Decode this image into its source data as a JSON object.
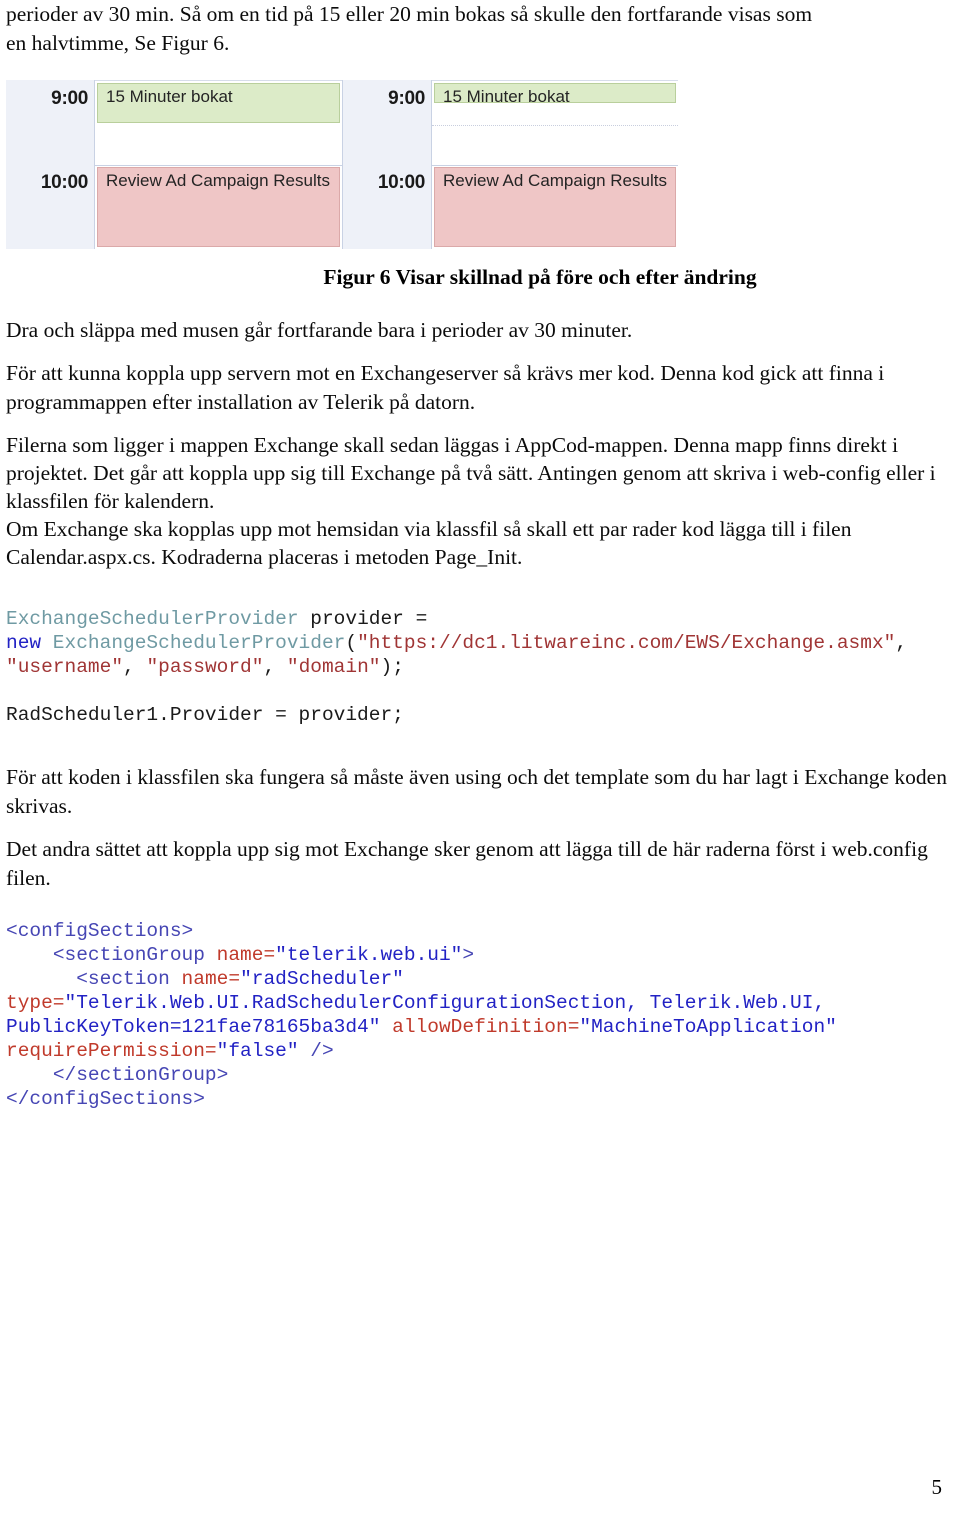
{
  "document": {
    "page_number": "5",
    "intro": {
      "line1": "perioder av 30 min. Så om en tid på 15 eller 20 min bokas så skulle den fortfarande visas som",
      "line2": "en halvtimme, Se Figur 6."
    },
    "figure": {
      "caption": "Figur 6 Visar skillnad på före och efter ändring",
      "before_panel": {
        "name": "före",
        "times": [
          "9:00",
          "10:00"
        ],
        "appointments": [
          {
            "label": "15 Minuter bokat",
            "color": "#dcebc8",
            "border": "#b9cf9c",
            "slot": "9:00",
            "duration_shown": "30 min"
          },
          {
            "label": "Review Ad Campaign Results",
            "color": "#efc6c6",
            "border": "#dba9a9",
            "slot": "10:00",
            "duration_shown": "60 min"
          }
        ]
      },
      "after_panel": {
        "name": "efter",
        "times": [
          "9:00",
          "10:00"
        ],
        "appointments": [
          {
            "label": "15 Minuter bokat",
            "color": "#dcebc8",
            "border": "#b9cf9c",
            "slot": "9:00",
            "duration_shown": "15 min"
          },
          {
            "label": "Review Ad Campaign Results",
            "color": "#efc6c6",
            "border": "#dba9a9",
            "slot": "10:00",
            "duration_shown": "60 min"
          }
        ]
      }
    },
    "paragraphs": {
      "p1": "Dra och släppa med musen går fortfarande bara i perioder av 30 minuter.",
      "p2": "För att kunna koppla upp servern mot en Exchangeserver så krävs mer kod. Denna kod gick att finna i programmappen efter installation av Telerik på datorn.",
      "p3": "Filerna som ligger i mappen Exchange skall sedan läggas i AppCod-mappen. Denna mapp finns direkt i projektet. Det går att koppla upp sig till Exchange på två sätt. Antingen genom att skriva i web-config eller i klassfilen för kalendern.",
      "p4": "Om Exchange ska kopplas upp mot hemsidan via klassfil så skall ett par rader kod lägga till i filen Calendar.aspx.cs. Kodraderna placeras i metoden Page_Init.",
      "p5": "För att koden i klassfilen ska fungera så måste även using och det template som du har lagt i Exchange koden skrivas.",
      "p6": "Det andra sättet att koppla upp sig mot Exchange sker genom att lägga till de här raderna först i web.config filen."
    },
    "code_csharp": {
      "l1_type": "ExchangeSchedulerProvider",
      "l1_rest": " provider =",
      "l2_kw": "new",
      "l2_type": " ExchangeSchedulerProvider",
      "l2_paren_open": "(",
      "l2_str": "\"https://dc1.litwareinc.com/EWS/Exchange.asmx\"",
      "l2_comma": ",",
      "l3_str1": "\"username\"",
      "l3_sep1": ", ",
      "l3_str2": "\"password\"",
      "l3_sep2": ", ",
      "l3_str3": "\"domain\"",
      "l3_end": ");",
      "l4": "RadScheduler1.Provider = provider;"
    },
    "code_xml": {
      "l1_tag": "<configSections>",
      "l2_indent": "    ",
      "l2_tag_open": "<sectionGroup ",
      "l2_attr": "name=",
      "l2_val": "\"telerik.web.ui\"",
      "l2_tag_close": ">",
      "l3_indent": "      ",
      "l3_tag_open": "<section ",
      "l3_attr": "name=",
      "l3_val": "\"radScheduler\"",
      "l4_attr": "type=",
      "l4_val": "\"Telerik.Web.UI.RadSchedulerConfigurationSection, Telerik.Web.UI,",
      "l5_val_cont": "PublicKeyToken=121fae78165ba3d4\"",
      "l5_attr": " allowDefinition=",
      "l5_val": "\"MachineToApplication\"",
      "l6_attr": "requirePermission=",
      "l6_val": "\"false\"",
      "l6_tag_close": " />",
      "l7_indent": "    ",
      "l7_tag": "</sectionGroup>",
      "l8_tag": "</configSections>"
    }
  }
}
